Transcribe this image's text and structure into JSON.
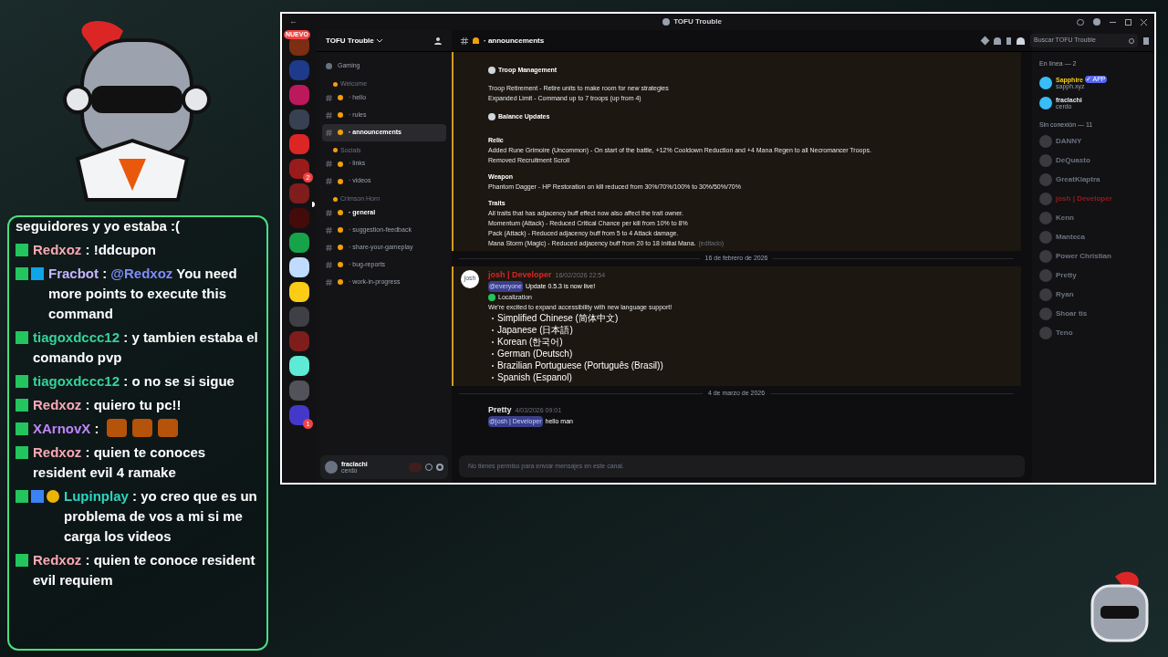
{
  "chat": {
    "messages": [
      {
        "kind": "continuation",
        "text": "seguidores y yo estaba :("
      },
      {
        "kind": "message",
        "user": "Redxoz",
        "color": "#f9a8b4",
        "badges": [
          {
            "kind": "mod"
          }
        ],
        "separator": ":",
        "text": "!ddcupon"
      },
      {
        "kind": "message",
        "user": "Fracbot",
        "color": "#c4b5fd",
        "badges": [
          {
            "kind": "mod"
          },
          {
            "kind": "bot"
          }
        ],
        "separator": ":",
        "mention": "@Redxoz",
        "text": "You need more points to execute this command"
      },
      {
        "kind": "message",
        "user": "tiagoxdccc12",
        "color": "#34d399",
        "badges": [
          {
            "kind": "mod"
          }
        ],
        "separator": ":",
        "text": "y tambien estaba el comando pvp"
      },
      {
        "kind": "message",
        "user": "tiagoxdccc12",
        "color": "#34d399",
        "badges": [
          {
            "kind": "mod"
          }
        ],
        "separator": ":",
        "text": "o no se si sigue"
      },
      {
        "kind": "message",
        "user": "Redxoz",
        "color": "#f9a8b4",
        "badges": [
          {
            "kind": "mod"
          }
        ],
        "separator": ":",
        "text": "quiero tu pc!!"
      },
      {
        "kind": "emotes",
        "user": "XArnovX",
        "color": "#c084fc",
        "badges": [
          {
            "kind": "mod"
          }
        ],
        "separator": ":",
        "emotes": [
          {
            "kind": "face"
          },
          {
            "kind": "face"
          },
          {
            "kind": "face"
          }
        ]
      },
      {
        "kind": "message",
        "user": "Redxoz",
        "color": "#f9a8b4",
        "badges": [
          {
            "kind": "mod"
          }
        ],
        "separator": ":",
        "text": "quien te conoces resident evil 4 ramake"
      },
      {
        "kind": "message",
        "user": "Lupinplay",
        "color": "#2dd4bf",
        "badges": [
          {
            "kind": "mod"
          },
          {
            "kind": "cube"
          },
          {
            "kind": "coin"
          }
        ],
        "separator": ":",
        "text": "yo creo que es un problema de vos a mi si me carga los videos"
      },
      {
        "kind": "message",
        "user": "Redxoz",
        "color": "#f9a8b4",
        "badges": [
          {
            "kind": "mod"
          }
        ],
        "separator": ":",
        "text": "quien te conoce resident evil requiem"
      }
    ]
  },
  "discord": {
    "window": {
      "title": "TOFU Trouble",
      "back": "←"
    },
    "servers": [
      {
        "color": "#7c2d12",
        "badge": "NUEVO"
      },
      {
        "color": "#1e3a8a"
      },
      {
        "color": "#be185d"
      },
      {
        "color": "#374151"
      },
      {
        "color": "#dc2626"
      },
      {
        "color": "#991b1b",
        "badge": "2"
      },
      {
        "color": "#7f1d1d"
      },
      {
        "color": "#450a0a"
      },
      {
        "color": "#16a34a"
      },
      {
        "color": "#bfdbfe"
      },
      {
        "color": "#facc15"
      },
      {
        "color": "#3f3f46"
      },
      {
        "color": "#7f1d1d"
      },
      {
        "color": "#5eead4"
      },
      {
        "color": "#52525b"
      },
      {
        "color": "#4338ca",
        "badge": "1"
      }
    ],
    "server_name": "TOFU Trouble",
    "channels": [
      {
        "kind": "voice",
        "name": "Gaming",
        "selected": false,
        "unread": false
      },
      {
        "kind": "category",
        "name": "Welcome"
      },
      {
        "kind": "channel",
        "name": "· hello",
        "selected": false,
        "unread": false
      },
      {
        "kind": "channel",
        "name": "· rules",
        "selected": false,
        "unread": false
      },
      {
        "kind": "channel",
        "name": "· announcements",
        "selected": true,
        "unread": false
      },
      {
        "kind": "category",
        "name": "Socials"
      },
      {
        "kind": "channel",
        "name": "· links",
        "selected": false,
        "unread": false
      },
      {
        "kind": "channel",
        "name": "· videos",
        "selected": false,
        "unread": false
      },
      {
        "kind": "category",
        "name": "Crimson Horn"
      },
      {
        "kind": "channel",
        "name": "· general",
        "selected": false,
        "unread": true
      },
      {
        "kind": "channel",
        "name": "· suggestion-feedback",
        "selected": false,
        "unread": false
      },
      {
        "kind": "channel",
        "name": "· share-your-gameplay",
        "selected": false,
        "unread": false
      },
      {
        "kind": "channel",
        "name": "· bug-reports",
        "selected": false,
        "unread": false
      },
      {
        "kind": "channel",
        "name": "· work-in-progress",
        "selected": false,
        "unread": false
      }
    ],
    "user_panel": {
      "name": "fraclachi",
      "status": "cerdo"
    },
    "header": {
      "channel": "· announcements",
      "search": {
        "placeholder": "Buscar TOFU Trouble"
      }
    },
    "messages": [
      {
        "kind": "body",
        "highlighted": true,
        "blocks": [
          {
            "kind": "heading",
            "text": "Troop Management"
          },
          {
            "kind": "line",
            "text": "Troop Retirement - Retire units to make room for new strategies"
          },
          {
            "kind": "line",
            "text": "Expanded Limit - Command up to 7 troops (up from 4)"
          },
          {
            "kind": "heading",
            "text": "Balance Updates"
          },
          {
            "kind": "sub",
            "text": "Relic"
          },
          {
            "kind": "line",
            "text": "Added Rune Grimoire (Uncommon) - On start of the battle, +12% Cooldown Reduction and +4 Mana Regen to all Necromancer Troops."
          },
          {
            "kind": "line",
            "text": "Removed Recruitment Scroll"
          },
          {
            "kind": "sub",
            "text": "Weapon"
          },
          {
            "kind": "line",
            "text": "Phantom Dagger - HP Restoration on kill reduced from 30%/70%/100% to 30%/50%/70%"
          },
          {
            "kind": "sub",
            "text": "Traits"
          },
          {
            "kind": "line",
            "text": "All traits that has adjacency buff effect now also affect the trait owner."
          },
          {
            "kind": "line",
            "text": "Momentum (Attack) - Reduced Critical Chance per kill from 10% to 8%"
          },
          {
            "kind": "line",
            "text": "Pack (Attack) - Reduced adjacency buff from 5 to 4 Attack damage."
          },
          {
            "kind": "line",
            "text": "Mana Storm (Magic) - Reduced adjacency buff from 20 to 18 Initial Mana.",
            "edited": "(editado)"
          }
        ]
      },
      {
        "kind": "divider",
        "text": "16 de febrero de 2026"
      },
      {
        "kind": "post",
        "highlighted": true,
        "author": "josh | Developer",
        "color": "#dc2626",
        "time": "16/02/2026 22:54",
        "avatar": "josh",
        "mention": "@everyone",
        "text": "Update 0.5.3 is now live!",
        "blocks": [
          {
            "kind": "line",
            "text": "Localization",
            "icon": true
          },
          {
            "kind": "line",
            "text": "We're excited to expand accessibility with new language support!"
          },
          {
            "kind": "bullet",
            "text": "Simplified Chinese (简体中文)"
          },
          {
            "kind": "bullet",
            "text": "Japanese (日本語)"
          },
          {
            "kind": "bullet",
            "text": "Korean (한국어)"
          },
          {
            "kind": "bullet",
            "text": "German (Deutsch)"
          },
          {
            "kind": "bullet",
            "text": "Brazilian Portuguese (Português (Brasil))"
          },
          {
            "kind": "bullet",
            "text": "Spanish (Espanol)"
          }
        ]
      },
      {
        "kind": "divider",
        "text": "4 de marzo de 2026"
      },
      {
        "kind": "post",
        "highlighted": false,
        "author": "Pretty",
        "color": "#e5e7eb",
        "time": "4/03/2026 09:01",
        "mention": "@josh | Developer",
        "text": "hello man"
      }
    ],
    "composer": {
      "placeholder": "No tienes permiso para enviar mensajes en este canal."
    },
    "members": {
      "online_heading": "En línea — 2",
      "online": [
        {
          "name": "Sapphire",
          "color": "#facc15",
          "tag": "✓ APP",
          "status": "sapph.xyz"
        },
        {
          "name": "fraclachi",
          "color": "#e5e7eb",
          "status": "cerdo"
        }
      ],
      "offline_heading": "Sin conexión — 11",
      "offline": [
        {
          "name": "DANNY",
          "color": "#6b7280"
        },
        {
          "name": "DeQuasto",
          "color": "#6b7280"
        },
        {
          "name": "GreatKlaptra",
          "color": "#6b7280"
        },
        {
          "name": "josh | Developer",
          "color": "#991b1b"
        },
        {
          "name": "Kenn",
          "color": "#6b7280"
        },
        {
          "name": "Manteca",
          "color": "#6b7280"
        },
        {
          "name": "Power Christian",
          "color": "#6b7280"
        },
        {
          "name": "Pretty",
          "color": "#6b7280"
        },
        {
          "name": "Ryan",
          "color": "#6b7280"
        },
        {
          "name": "Shoar tis",
          "color": "#6b7280"
        },
        {
          "name": "Teno",
          "color": "#6b7280"
        }
      ]
    }
  }
}
